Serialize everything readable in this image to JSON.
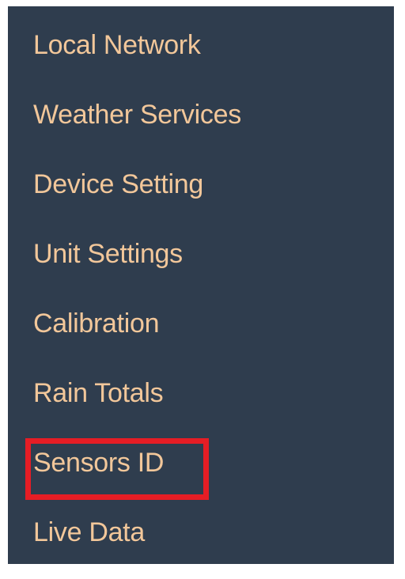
{
  "menu": {
    "items": [
      {
        "id": "local-network",
        "label": "Local Network"
      },
      {
        "id": "weather-services",
        "label": "Weather Services"
      },
      {
        "id": "device-setting",
        "label": "Device Setting"
      },
      {
        "id": "unit-settings",
        "label": "Unit Settings"
      },
      {
        "id": "calibration",
        "label": "Calibration"
      },
      {
        "id": "rain-totals",
        "label": "Rain Totals"
      },
      {
        "id": "sensors-id",
        "label": "Sensors ID"
      },
      {
        "id": "live-data",
        "label": "Live Data"
      }
    ],
    "highlighted_item": "sensors-id"
  },
  "colors": {
    "background": "#2f3d4e",
    "text": "#f2c79a",
    "highlight_border": "#e61d25"
  }
}
